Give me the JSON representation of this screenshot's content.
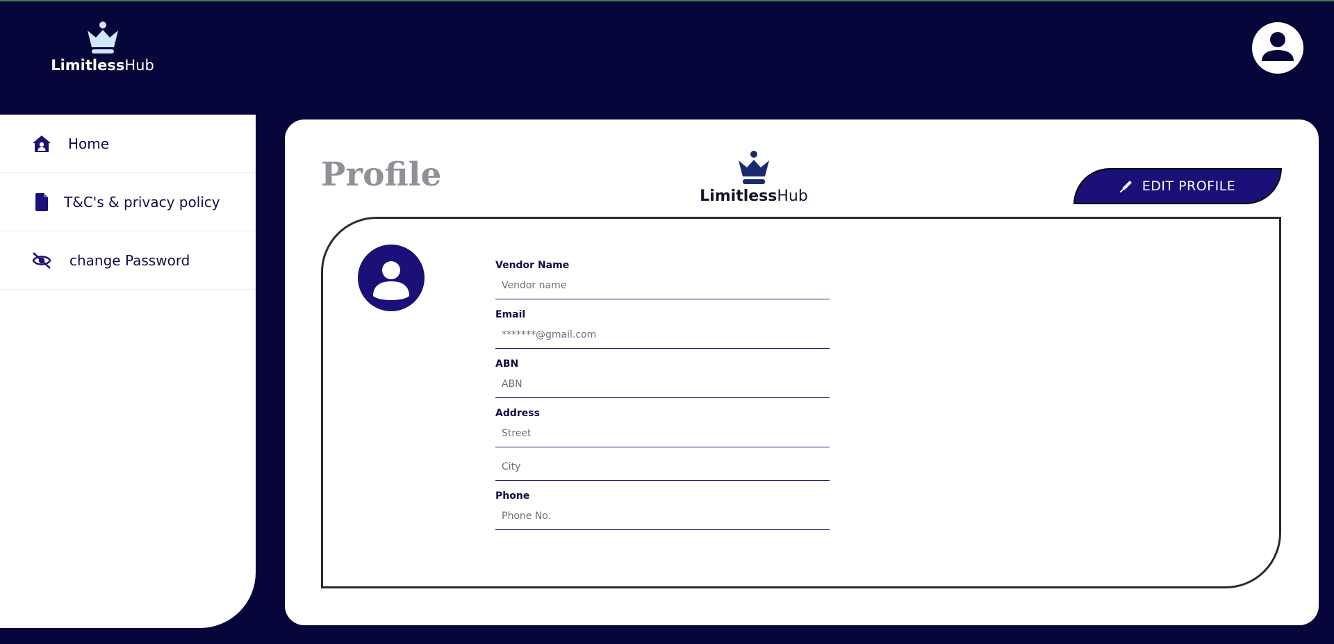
{
  "brand": {
    "bold": "Limitless",
    "regular": "Hub"
  },
  "sidebar": {
    "items": [
      {
        "label": "Home",
        "icon": "home-user-icon"
      },
      {
        "label": "T&C's & privacy policy",
        "icon": "file-icon"
      },
      {
        "label": "change Password",
        "icon": "eye-slash-icon"
      }
    ]
  },
  "main": {
    "title": "Profile",
    "edit_button": "EDIT PROFILE",
    "fields": {
      "vendor": {
        "label": "Vendor Name",
        "placeholder": "Vendor name"
      },
      "email": {
        "label": "Email",
        "placeholder": "*******@gmail.com"
      },
      "abn": {
        "label": "ABN",
        "placeholder": "ABN"
      },
      "address": {
        "label": "Address",
        "street_placeholder": "Street",
        "city_placeholder": "City"
      },
      "phone": {
        "label": "Phone",
        "placeholder": "Phone No."
      }
    }
  },
  "colors": {
    "background": "#06063a",
    "accent": "#1b0f78",
    "logo_light": "#cfe6fb",
    "logo_dark": "#1b2a6e"
  }
}
